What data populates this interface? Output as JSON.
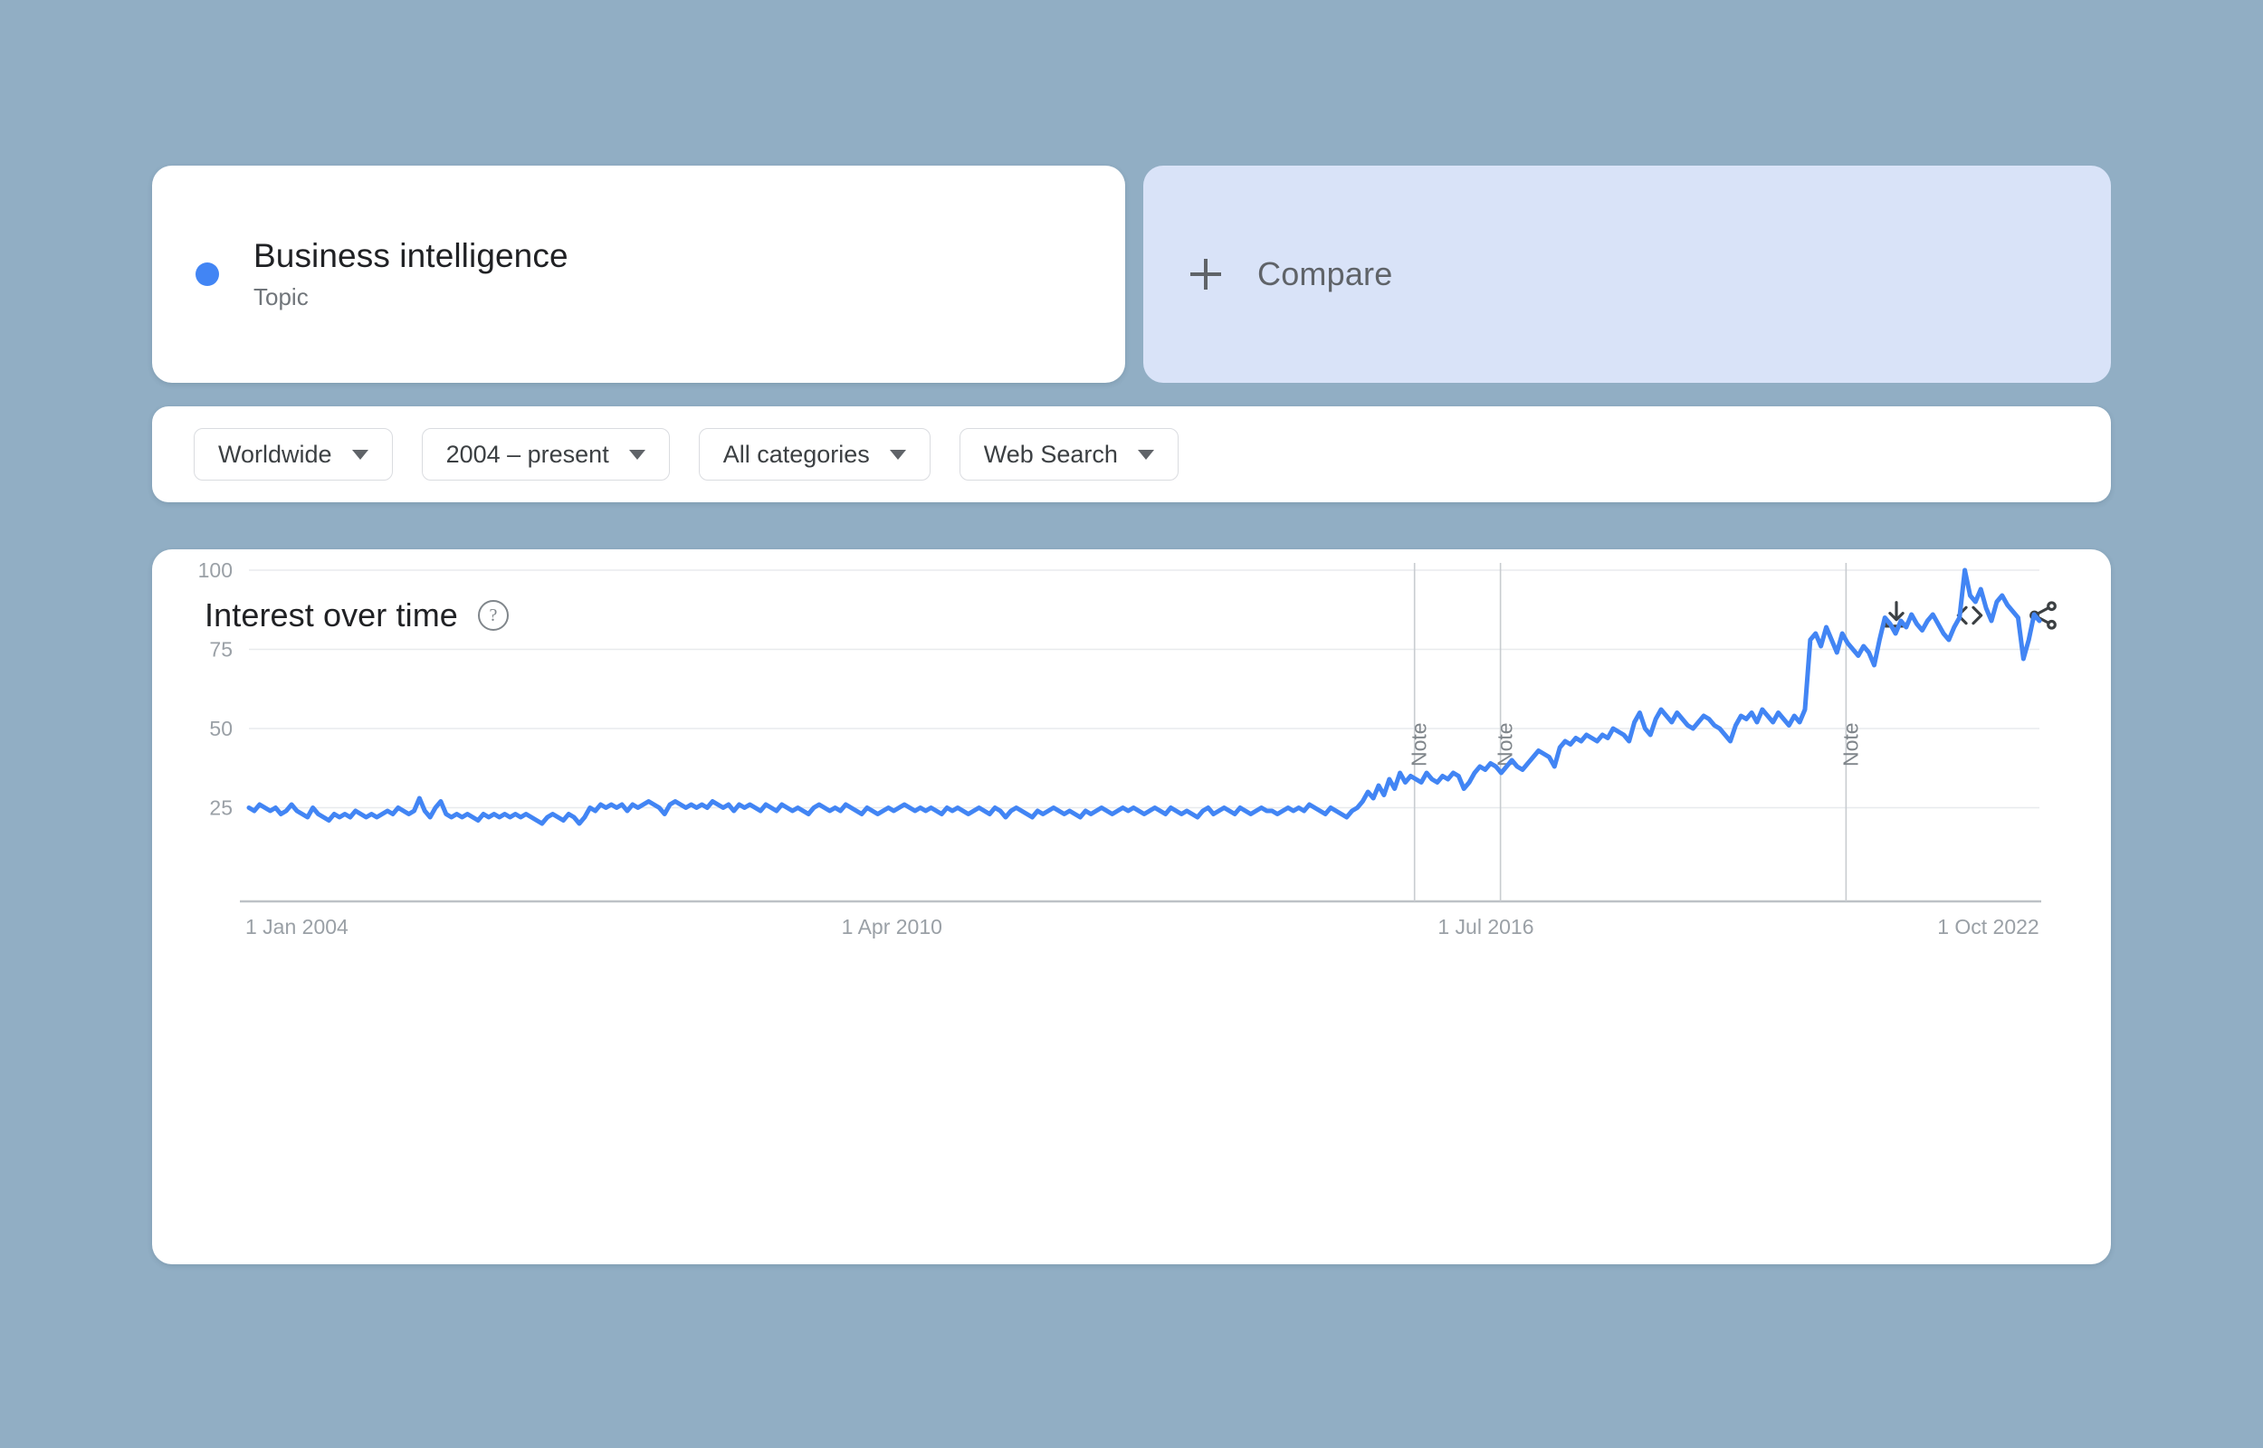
{
  "topic_card": {
    "name": "Business intelligence",
    "type_label": "Topic",
    "dot_color": "#4285F4"
  },
  "compare_card": {
    "label": "Compare",
    "icon": "plus-icon",
    "background": "#D9E3F8"
  },
  "filters": [
    {
      "label": "Worldwide",
      "name": "location-filter"
    },
    {
      "label": "2004 – present",
      "name": "time-range-filter"
    },
    {
      "label": "All categories",
      "name": "category-filter"
    },
    {
      "label": "Web Search",
      "name": "search-type-filter"
    }
  ],
  "chart_card": {
    "title": "Interest over time",
    "help_icon": "question-mark-circle-icon",
    "actions": [
      {
        "name": "download-csv-icon",
        "label": "download"
      },
      {
        "name": "embed-code-icon",
        "label": "embed"
      },
      {
        "name": "share-icon",
        "label": "share"
      }
    ]
  },
  "chart_data": {
    "type": "line",
    "title": "Interest over time",
    "xlabel": "",
    "ylabel": "",
    "ylim": [
      0,
      100
    ],
    "yticks": [
      25,
      50,
      75,
      100
    ],
    "xticks": [
      "1 Jan 2004",
      "1 Apr 2010",
      "1 Jul 2016",
      "1 Oct 2022"
    ],
    "xtick_positions": [
      0,
      0.333,
      0.666,
      0.945
    ],
    "grid": true,
    "legend_position": "none",
    "series_color": "#4285F4",
    "annotations": [
      {
        "label": "Note",
        "position": 0.651
      },
      {
        "label": "Note",
        "position": 0.699
      },
      {
        "label": "Note",
        "position": 0.892
      }
    ],
    "x_start": "1 Jan 2004",
    "x_end": "present",
    "values": [
      25,
      24,
      26,
      25,
      24,
      25,
      23,
      24,
      26,
      24,
      23,
      22,
      25,
      23,
      22,
      21,
      23,
      22,
      23,
      22,
      24,
      23,
      22,
      23,
      22,
      23,
      24,
      23,
      25,
      24,
      23,
      24,
      28,
      24,
      22,
      25,
      27,
      23,
      22,
      23,
      22,
      23,
      22,
      21,
      23,
      22,
      23,
      22,
      23,
      22,
      23,
      22,
      23,
      22,
      21,
      20,
      22,
      23,
      22,
      21,
      23,
      22,
      20,
      22,
      25,
      24,
      26,
      25,
      26,
      25,
      26,
      24,
      26,
      25,
      26,
      27,
      26,
      25,
      23,
      26,
      27,
      26,
      25,
      26,
      25,
      26,
      25,
      27,
      26,
      25,
      26,
      24,
      26,
      25,
      26,
      25,
      24,
      26,
      25,
      24,
      26,
      25,
      24,
      25,
      24,
      23,
      25,
      26,
      25,
      24,
      25,
      24,
      26,
      25,
      24,
      23,
      25,
      24,
      23,
      24,
      25,
      24,
      25,
      26,
      25,
      24,
      25,
      24,
      25,
      24,
      23,
      25,
      24,
      25,
      24,
      23,
      24,
      25,
      24,
      23,
      25,
      24,
      22,
      24,
      25,
      24,
      23,
      22,
      24,
      23,
      24,
      25,
      24,
      23,
      24,
      23,
      22,
      24,
      23,
      24,
      25,
      24,
      23,
      24,
      25,
      24,
      25,
      24,
      23,
      24,
      25,
      24,
      23,
      25,
      24,
      23,
      24,
      23,
      22,
      24,
      25,
      23,
      24,
      25,
      24,
      23,
      25,
      24,
      23,
      24,
      25,
      24,
      24,
      23,
      24,
      25,
      24,
      25,
      24,
      26,
      25,
      24,
      23,
      25,
      24,
      23,
      22,
      24,
      25,
      27,
      30,
      28,
      32,
      29,
      34,
      31,
      36,
      33,
      35,
      34,
      33,
      36,
      34,
      33,
      35,
      34,
      36,
      35,
      31,
      33,
      36,
      38,
      37,
      39,
      38,
      36,
      38,
      40,
      38,
      37,
      39,
      41,
      43,
      42,
      41,
      38,
      44,
      46,
      45,
      47,
      46,
      48,
      47,
      46,
      48,
      47,
      50,
      49,
      48,
      46,
      52,
      55,
      50,
      48,
      53,
      56,
      54,
      52,
      55,
      53,
      51,
      50,
      52,
      54,
      53,
      51,
      50,
      48,
      46,
      51,
      54,
      53,
      55,
      52,
      56,
      54,
      52,
      55,
      53,
      51,
      54,
      52,
      56,
      78,
      80,
      76,
      82,
      78,
      74,
      80,
      77,
      75,
      73,
      76,
      74,
      70,
      78,
      85,
      83,
      80,
      84,
      82,
      86,
      83,
      81,
      84,
      86,
      83,
      80,
      78,
      82,
      85,
      100,
      92,
      90,
      94,
      88,
      84,
      90,
      92,
      89,
      87,
      85,
      72,
      78,
      86,
      84
    ]
  }
}
